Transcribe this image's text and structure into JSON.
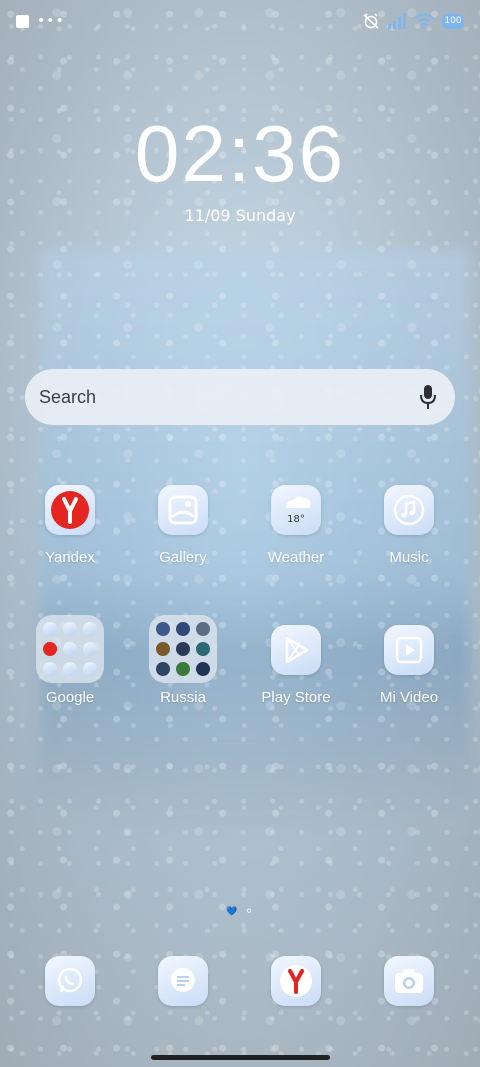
{
  "clock": {
    "time": "02:36",
    "date": "11/09 Sunday"
  },
  "search": {
    "placeholder": "Search"
  },
  "apps": [
    {
      "label": "Yandex",
      "icon": "yandex-icon"
    },
    {
      "label": "Gallery",
      "icon": "gallery-icon"
    },
    {
      "label": "Weather",
      "icon": "weather-icon",
      "temp": "18°"
    },
    {
      "label": "Music",
      "icon": "music-icon"
    },
    {
      "label": "Google",
      "icon": "folder-icon"
    },
    {
      "label": "Russia",
      "icon": "folder-icon"
    },
    {
      "label": "Play Store",
      "icon": "play-store-icon"
    },
    {
      "label": "Mi Video",
      "icon": "mi-video-icon"
    }
  ],
  "dock": [
    {
      "icon": "whatsapp-icon"
    },
    {
      "icon": "messages-icon"
    },
    {
      "icon": "yandex-browser-icon"
    },
    {
      "icon": "camera-icon"
    }
  ],
  "status": {
    "battery": "100"
  },
  "colors": {
    "accent": "#7fb5ef",
    "yandex_red": "#e52620"
  }
}
